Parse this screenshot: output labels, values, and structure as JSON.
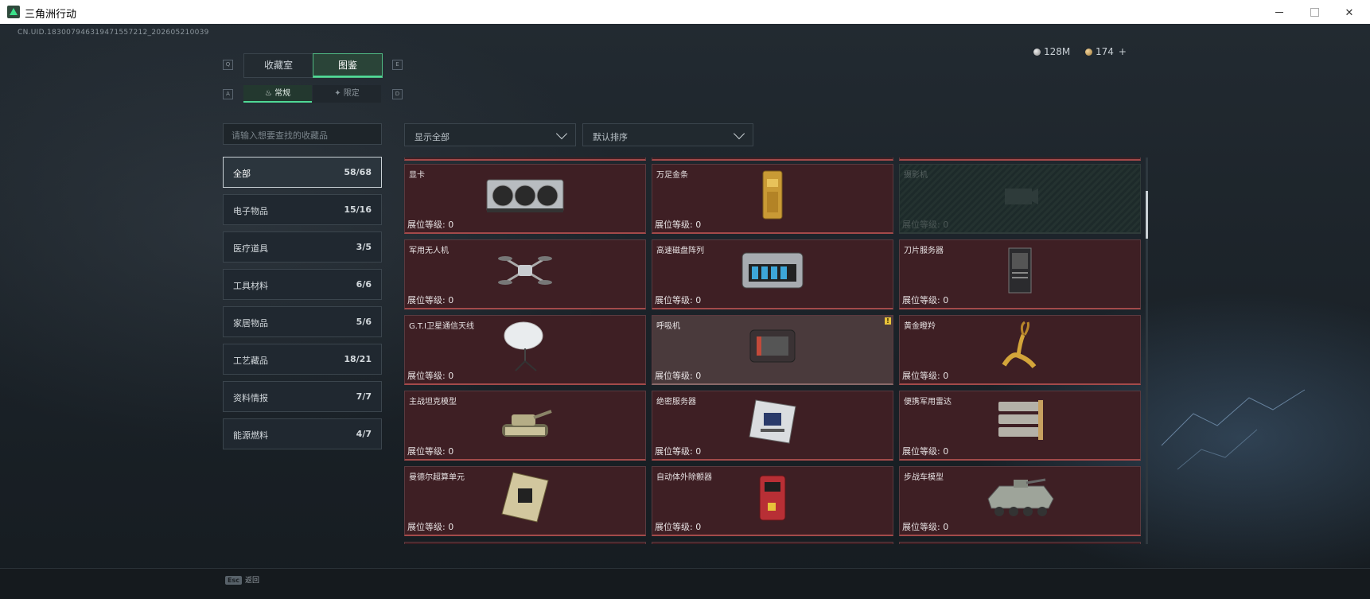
{
  "window": {
    "title": "三角洲行动"
  },
  "uid": "CN.UID.183007946319471557212_202605210039",
  "currency": {
    "silver": "128M",
    "gold": "174",
    "add": "+"
  },
  "top_tabs": {
    "left_key": "Q",
    "right_key": "E",
    "tab1": "收藏室",
    "tab2": "图鉴"
  },
  "sub_tabs": {
    "left_key": "A",
    "right_key": "D",
    "tab1": "常规",
    "tab2": "限定"
  },
  "search": {
    "placeholder": "请输入想要查找的收藏品"
  },
  "categories": [
    {
      "name": "全部",
      "count": "58/68"
    },
    {
      "name": "电子物品",
      "count": "15/16"
    },
    {
      "name": "医疗道具",
      "count": "3/5"
    },
    {
      "name": "工具材料",
      "count": "6/6"
    },
    {
      "name": "家居物品",
      "count": "5/6"
    },
    {
      "name": "工艺藏品",
      "count": "18/21"
    },
    {
      "name": "资料情报",
      "count": "7/7"
    },
    {
      "name": "能源燃料",
      "count": "4/7"
    }
  ],
  "filters": {
    "show": "显示全部",
    "sort": "默认排序"
  },
  "level_label": "展位等级: 0",
  "items": [
    {
      "name": "显卡",
      "icon": "gpu-icon"
    },
    {
      "name": "万足金条",
      "icon": "gold-bar-icon"
    },
    {
      "name": "摄影机",
      "icon": "camera-icon"
    },
    {
      "name": "军用无人机",
      "icon": "drone-icon"
    },
    {
      "name": "高速磁盘阵列",
      "icon": "disk-array-icon"
    },
    {
      "name": "刀片服务器",
      "icon": "blade-server-icon"
    },
    {
      "name": "G.T.I卫星通信天线",
      "icon": "satellite-dish-icon"
    },
    {
      "name": "呼吸机",
      "icon": "ventilator-icon"
    },
    {
      "name": "黄金瞪羚",
      "icon": "golden-gazelle-icon"
    },
    {
      "name": "主战坦克模型",
      "icon": "tank-model-icon"
    },
    {
      "name": "绝密服务器",
      "icon": "secret-server-icon"
    },
    {
      "name": "便携军用雷达",
      "icon": "radar-icon"
    },
    {
      "name": "曼德尔超算单元",
      "icon": "supercomputer-icon"
    },
    {
      "name": "自动体外除颤器",
      "icon": "defibrillator-icon"
    },
    {
      "name": "步战车模型",
      "icon": "ifv-model-icon"
    }
  ],
  "footer": {
    "esc_key": "Esc",
    "esc_label": "返回"
  },
  "colors": {
    "accent": "#4fd896",
    "card": "#3e1f24",
    "card_border": "#a34a4a",
    "warning_flag": "#e8c23a"
  }
}
